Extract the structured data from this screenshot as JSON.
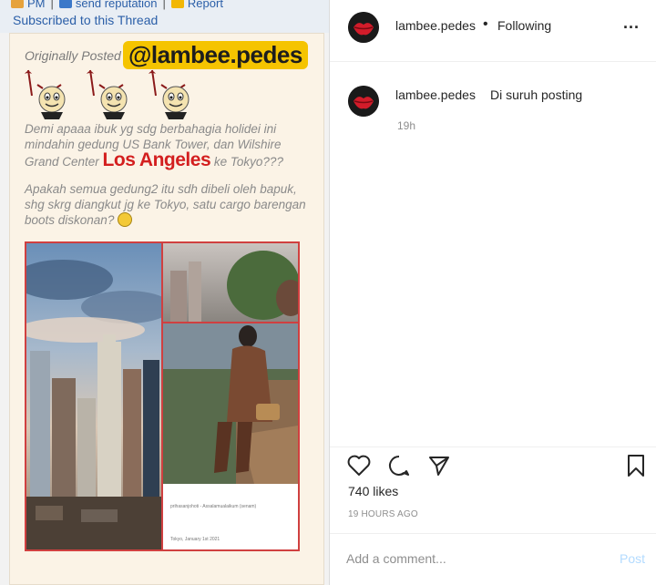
{
  "colors": {
    "accent_link": "#2b5fa8",
    "quote_text": "#8a8a8a",
    "highlight_red": "#d31f1f",
    "handle_bg": "#f5c400",
    "meta_gray": "#8e8e8e",
    "post_button": "#b3dbff"
  },
  "forum": {
    "links": [
      "PM",
      "send reputation",
      "Report"
    ],
    "subscribed": "Subscribed to this Thread",
    "originally_posted": "Originally Posted",
    "handle": "@lambee.pedes",
    "quote_part1": "Demi apaaa ibuk yg sdg berbahagia holidei ini mindahin gedung US Bank Tower, dan Wilshire Grand Center ",
    "quote_highlight": "Los Angeles",
    "quote_part2": " ke Tokyo???",
    "quote_paragraph2": "Apakah semua gedung2 itu sdh dibeli oleh bapuk, shg skrg diangkut jg ke Tokyo, satu cargo barengan boots diskonan?",
    "icons": [
      "devil-smiley-icon",
      "devil-smiley-icon",
      "devil-smiley-icon",
      "thinking-face-icon"
    ],
    "photo_caption": "prihasanjohoti - Assalamualaikum (senam)",
    "photo_date": "Tokyo, January 1st 2021"
  },
  "header": {
    "username": "lambee.pedes",
    "separator": "•",
    "following": "Following",
    "more": "..."
  },
  "caption": {
    "username": "lambee.pedes",
    "text": "Di suruh posting",
    "time": "19h"
  },
  "actions": {
    "icons": [
      "heart-icon",
      "comment-icon",
      "share-icon",
      "bookmark-icon"
    ],
    "likes": "740 likes",
    "time_ago": "19 HOURS AGO"
  },
  "comment_box": {
    "placeholder": "Add a comment...",
    "post_label": "Post"
  }
}
